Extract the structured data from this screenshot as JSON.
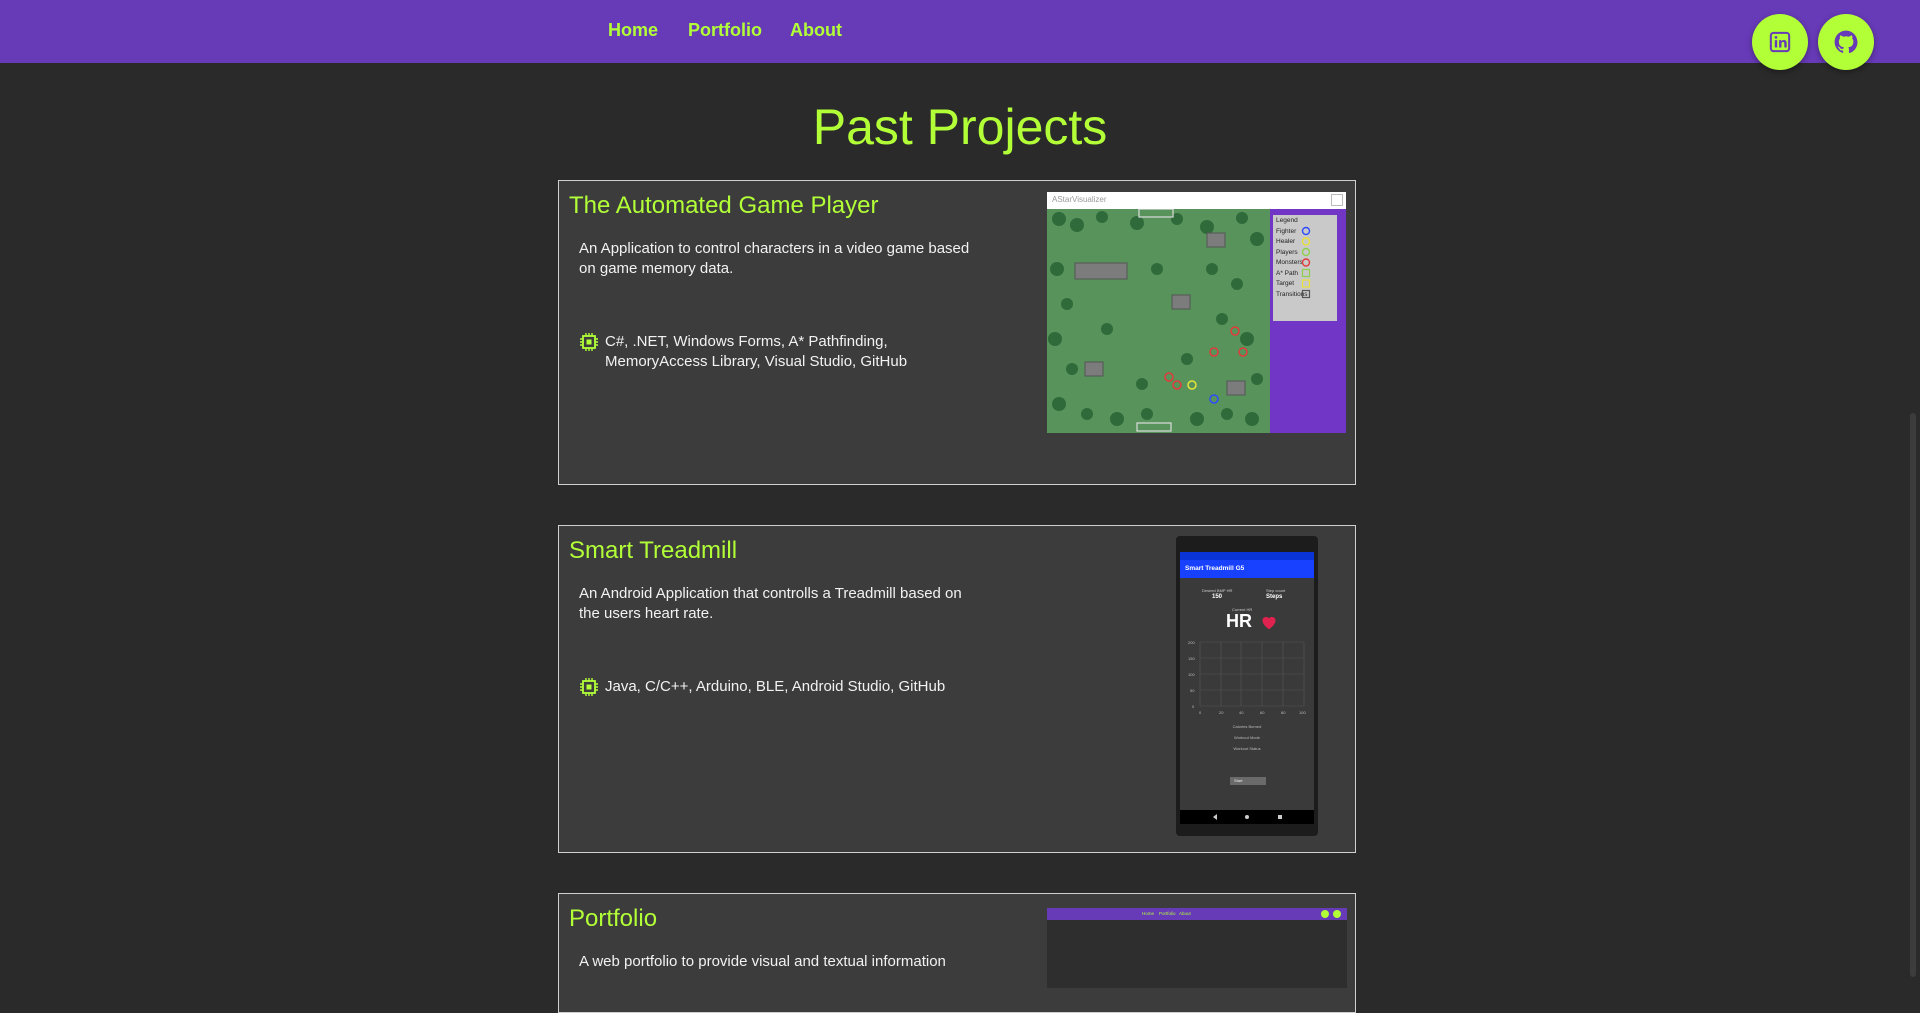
{
  "nav": {
    "links": [
      "Home",
      "Portfolio",
      "About"
    ]
  },
  "social": {
    "linkedin_icon": "linkedin-icon",
    "github_icon": "github-icon"
  },
  "page": {
    "title": "Past Projects"
  },
  "projects": [
    {
      "title": "The Automated Game Player",
      "description": "An Application to control characters in a video game based on game memory data.",
      "tech": "C#, .NET, Windows Forms, A* Pathfinding, MemoryAccess Library, Visual Studio, GitHub",
      "screenshot": {
        "window_title": "AStarVisualizer",
        "legend": {
          "title": "Legend",
          "items": [
            "Fighter",
            "Healer",
            "Players",
            "Monsters",
            "A* Path",
            "Target",
            "Transitions"
          ]
        }
      }
    },
    {
      "title": "Smart Treadmill",
      "description": "An Android Application that controlls a Treadmill based on the users heart rate.",
      "tech": "Java, C/C++, Arduino, BLE, Android Studio, GitHub",
      "screenshot": {
        "app_title": "Smart Treadmill G5",
        "stat1_label": "Desired BMP HR",
        "stat1_value": "150",
        "stat2_label": "Step count",
        "stat2_value": "Steps",
        "hr_label": "Current HR",
        "hr_value": "HR",
        "y_ticks": [
          "200",
          "150",
          "100",
          "50",
          "0"
        ],
        "x_ticks": [
          "0",
          "20",
          "40",
          "60",
          "80",
          "100"
        ],
        "info_lines": [
          "Calories Burned",
          "Workout Mode",
          "Workout Status"
        ],
        "button": "Start"
      }
    },
    {
      "title": "Portfolio",
      "description": "A web portfolio to provide visual and textual information",
      "screenshot": {
        "nav": [
          "Home",
          "Portfolio",
          "About"
        ]
      }
    }
  ],
  "colors": {
    "accent": "#b2ff37",
    "brand": "#673ab7",
    "background": "#2a2a2a",
    "card": "#3c3c3c"
  }
}
